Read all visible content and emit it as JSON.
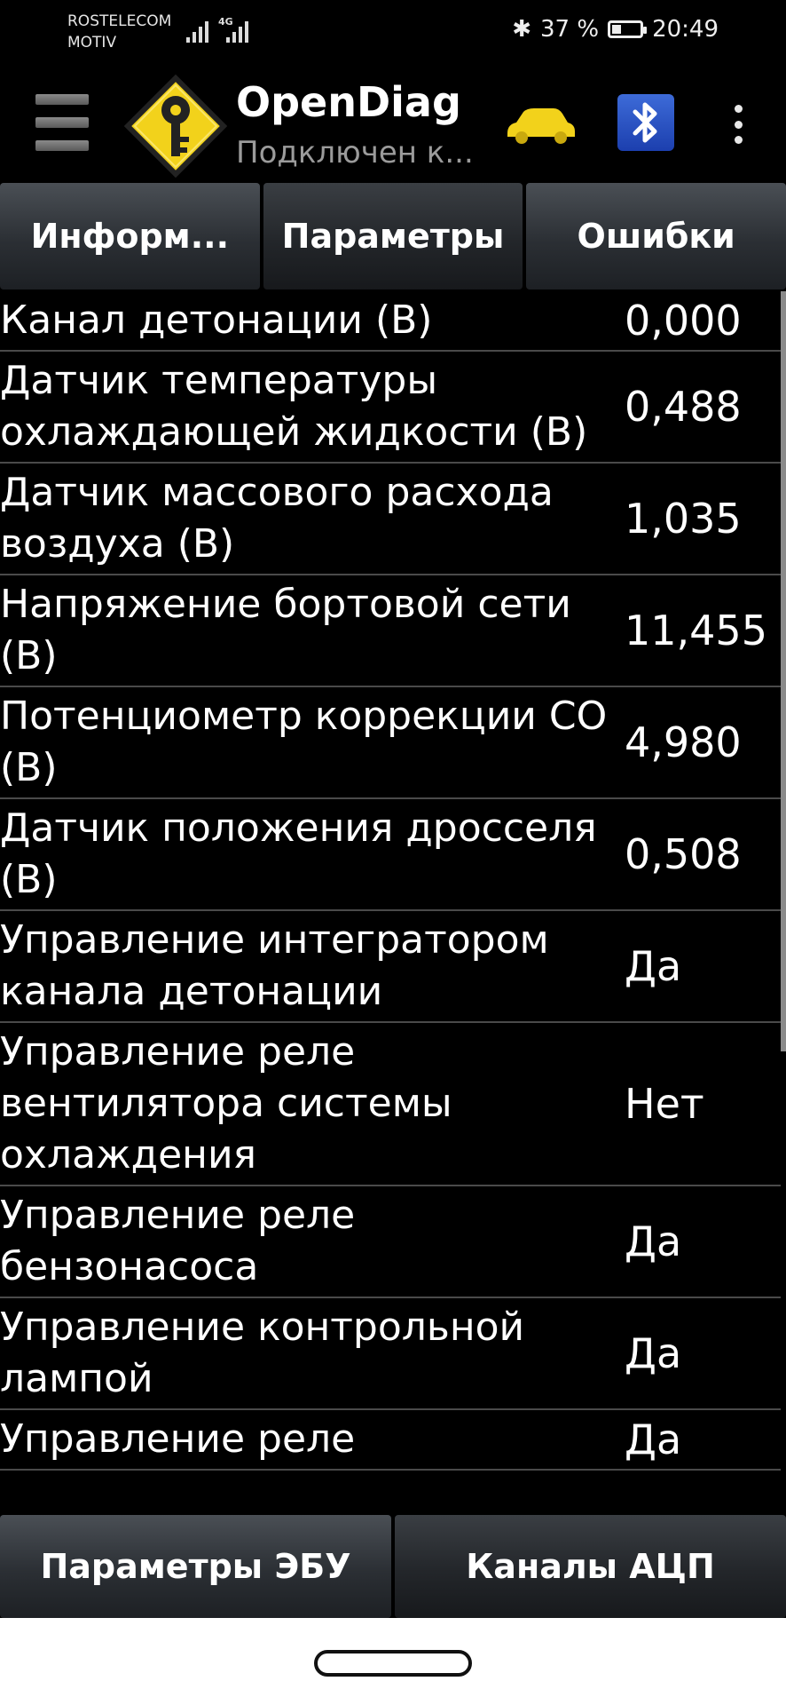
{
  "status_bar": {
    "carrier_1": "ROSTELECOM",
    "carrier_2": "MOTIV",
    "network": "4G",
    "battery": "37 %",
    "battery_level_percent": 37,
    "time": "20:49"
  },
  "app_bar": {
    "title": "OpenDiag",
    "subtitle": "Подключен к..."
  },
  "tabs": [
    {
      "label": "Информ..."
    },
    {
      "label": "Параметры"
    },
    {
      "label": "Ошибки"
    }
  ],
  "parameters": [
    {
      "name": "Канал детонации (В)",
      "value": "0,000"
    },
    {
      "name": "Датчик температуры охлаждающей жидкости (В)",
      "value": "0,488"
    },
    {
      "name": "Датчик массового расхода воздуха (В)",
      "value": "1,035"
    },
    {
      "name": "Напряжение бортовой сети (В)",
      "value": "11,455"
    },
    {
      "name": "Потенциометр коррекции СО (В)",
      "value": "4,980"
    },
    {
      "name": "Датчик положения дросселя (В)",
      "value": "0,508"
    },
    {
      "name": "Управление интегратором канала детонации",
      "value": "Да"
    },
    {
      "name": "Управление реле вентилятора системы охлаждения",
      "value": "Нет"
    },
    {
      "name": "Управление реле бензонасоса",
      "value": "Да"
    },
    {
      "name": "Управление контрольной лампой",
      "value": "Да"
    },
    {
      "name": "Управление реле",
      "value": "Да"
    }
  ],
  "bottom_buttons": [
    {
      "label": "Параметры ЭБУ"
    },
    {
      "label": "Каналы АЦП"
    }
  ],
  "colors": {
    "background": "#000000",
    "logo_yellow": "#f2d21b",
    "bluetooth_blue": "#2a52c9"
  }
}
